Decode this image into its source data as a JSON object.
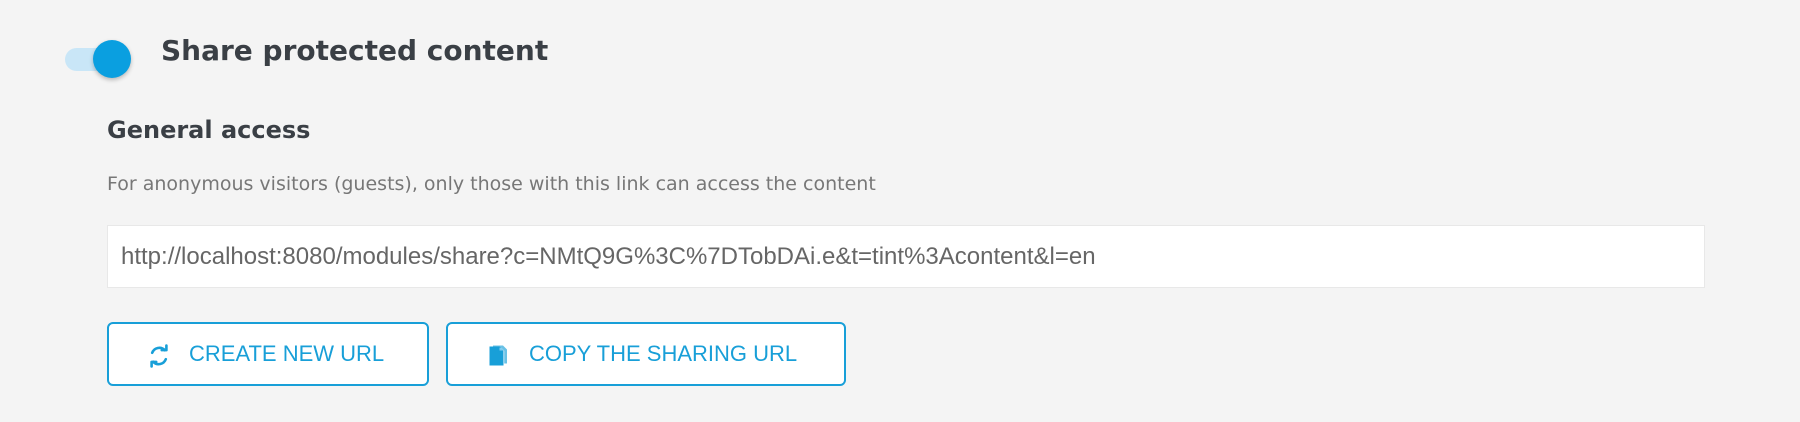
{
  "share": {
    "toggle_state": true,
    "title": "Share protected content"
  },
  "general_access": {
    "title": "General access",
    "description": "For anonymous visitors (guests), only those with this link can access the content",
    "url": "http://localhost:8080/modules/share?c=NMtQ9G%3C%7DTobDAi.e&t=tint%3Acontent&l=en"
  },
  "actions": {
    "create_label": "CREATE NEW URL",
    "create_icon": "refresh-icon",
    "copy_label": "COPY THE SHARING URL",
    "copy_icon": "copy-document-icon"
  },
  "colors": {
    "accent": "#0a9fe0",
    "accent_light": "#c9e6f7",
    "button": "#189fd8",
    "text_primary": "#3a3f45",
    "text_secondary": "#777777",
    "background": "#f4f4f4"
  }
}
